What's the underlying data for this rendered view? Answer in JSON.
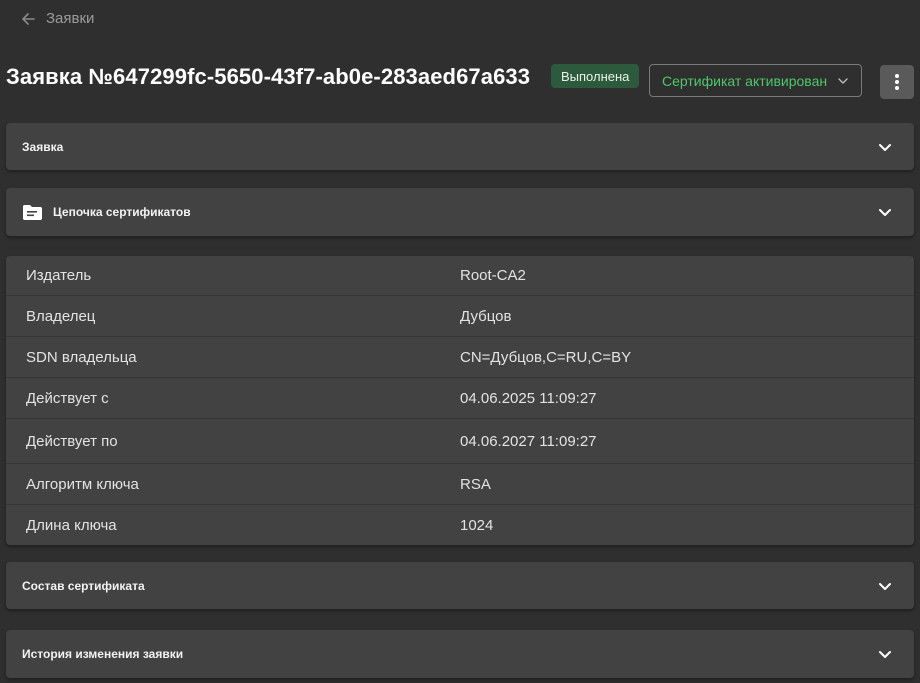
{
  "nav": {
    "back_label": "Заявки"
  },
  "header": {
    "title": "Заявка №647299fc-5650-43f7-ab0e-283aed67a633",
    "badge": "Выполнена",
    "status_select": "Сертификат активирован"
  },
  "sections": {
    "request": "Заявка",
    "chain": "Цепочка сертификатов",
    "composition": "Состав сертификата",
    "history": "История изменения заявки"
  },
  "details": [
    {
      "label": "Издатель",
      "value": "Root-CA2"
    },
    {
      "label": "Владелец",
      "value": "Дубцов"
    },
    {
      "label": "SDN владельца",
      "value": "CN=Дубцов,C=RU,C=BY"
    },
    {
      "label": "Действует с",
      "value": "04.06.2025 11:09:27"
    },
    {
      "label": "Действует по",
      "value": "04.06.2027 11:09:27"
    },
    {
      "label": "Алгоритм ключа",
      "value": "RSA"
    },
    {
      "label": "Длина ключа",
      "value": "1024"
    }
  ],
  "colors": {
    "background": "#2f2f2f",
    "panel": "#424242",
    "badge_bg": "#2d5a3c",
    "status_text": "#4dc76a"
  },
  "icons": [
    "arrow-left-icon",
    "chevron-down-icon",
    "more-vertical-icon",
    "folder-icon"
  ]
}
